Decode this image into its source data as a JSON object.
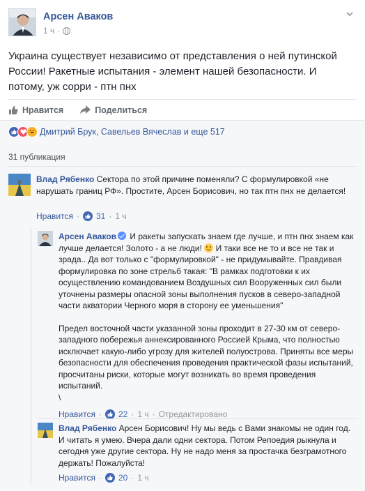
{
  "post": {
    "author": "Арсен Аваков",
    "time": "1 ч",
    "text": "Украина существует независимо от представления о ней путинской России! Ракетные испытания - элемент нашей безопасности. И потому, уж сорри - птн пнх"
  },
  "actions": {
    "like": "Нравится",
    "share": "Поделиться"
  },
  "reactions": {
    "summary": "Дмитрий Брук, Савельев Вячеслав и еще 517"
  },
  "comments_count": "31 публикация",
  "comments": [
    {
      "author": "Влад Рябенко",
      "text": "Сектора по этой причине поменяли? С формулировкой «не нарушать границ РФ». Простите, Арсен Борисович, но так птн пнх не делается!",
      "like_label": "Нравится",
      "likes": "31",
      "time": "1 ч",
      "sep": "·"
    }
  ],
  "replies": [
    {
      "author": "Арсен Аваков",
      "text_a": "И ракеты запускать знаем где лучше, и птн пнх знаем как лучше делается! Золото - а не люди!",
      "text_b": "И таки все не то и все не так и зрада.. Да вот только с \"формулировкой\" - не придумывайте. Правдивая формулировка по зоне стрельб такая: \"В рамках подготовки к их осуществлению командованием Воздушных сил Вооруженных сил были уточнены размеры опасной зоны выполнения пусков в северо-западной части акватории Черного моря в сторону ее уменьшения\"",
      "text_c": "Предел восточной части указанной зоны проходит в 27-30 км от северо-западного побережья аннексированного Россией Крыма, что полностью исключает какую-либо угрозу для жителей полуострова. Приняты все меры безопасности для обеспечения проведения практической фазы испытаний, просчитаны риски, которые могут возникать во время проведения испытаний.",
      "text_d": "\\",
      "like_label": "Нравится",
      "likes": "22",
      "time": "1 ч",
      "edited": "Отредактировано",
      "sep": "·"
    },
    {
      "author": "Влад Рябенко",
      "text": "Арсен Борисович! Ну мы ведь с Вами знакомы не один год. И читать я умею. Вчера дали одни сектора. Потом Репоедия рыкнула и сегодня уже другие сектора. Ну не надо меня за простачка безграмотного держать! Пожалуйста!",
      "like_label": "Нравится",
      "likes": "20",
      "time": "1 ч",
      "sep": "·"
    }
  ],
  "colors": {
    "link": "#365899",
    "meta": "#90949c",
    "like_blue": "#4267b2",
    "comments_bg": "#f6f7f9"
  }
}
